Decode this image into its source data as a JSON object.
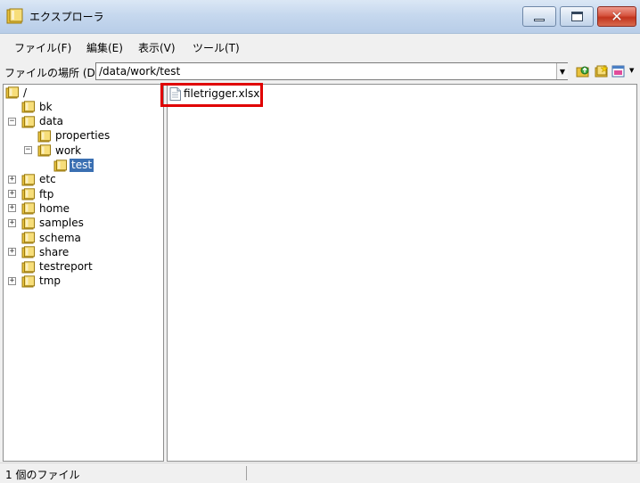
{
  "window": {
    "title": "エクスプローラ",
    "controls": {
      "minimize_icon": "minimize-icon",
      "maximize_icon": "maximize-icon",
      "close_glyph": "✕"
    }
  },
  "menu": [
    {
      "label": "ファイル(F)"
    },
    {
      "label": "編集(E)"
    },
    {
      "label": "表示(V)"
    },
    {
      "label": "ツール(T)"
    }
  ],
  "address": {
    "label": "ファイルの場所 (D)",
    "value": "/data/work/test",
    "toolbar_icons": [
      "folder-up-icon",
      "new-folder-icon",
      "view-menu-icon"
    ]
  },
  "tree": [
    {
      "label": "/",
      "expander": ""
    },
    {
      "label": "bk",
      "expander": ""
    },
    {
      "label": "data",
      "expander": "⊟"
    },
    {
      "label": "properties",
      "expander": ""
    },
    {
      "label": "work",
      "expander": "⊟"
    },
    {
      "label": "test",
      "expander": "",
      "selected": true
    },
    {
      "label": "etc",
      "expander": "+"
    },
    {
      "label": "ftp",
      "expander": "+"
    },
    {
      "label": "home",
      "expander": "+"
    },
    {
      "label": "samples",
      "expander": "+"
    },
    {
      "label": "schema",
      "expander": ""
    },
    {
      "label": "share",
      "expander": "+"
    },
    {
      "label": "testreport",
      "expander": ""
    },
    {
      "label": "tmp",
      "expander": "+"
    }
  ],
  "files": [
    {
      "name": "filetrigger.xlsx",
      "icon": "document-icon"
    }
  ],
  "status": {
    "text": "1 個のファイル"
  },
  "colors": {
    "selection": "#3a6fb2",
    "highlight_box": "#e00000",
    "folder": "#e9c23c"
  }
}
